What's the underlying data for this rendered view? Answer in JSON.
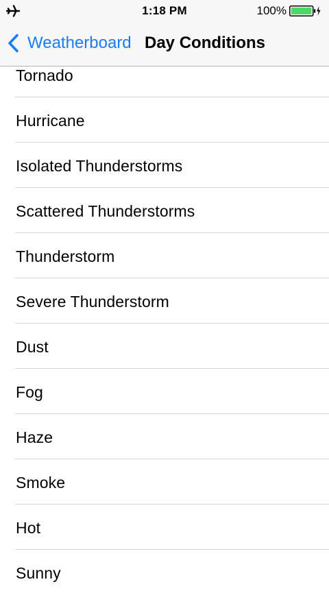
{
  "status_bar": {
    "time": "1:18 PM",
    "battery_percent": "100%",
    "airplane_icon": "airplane-icon",
    "battery_icon": "battery-charging-icon"
  },
  "nav": {
    "back_label": "Weatherboard",
    "back_icon": "chevron-left-icon",
    "title": "Day Conditions",
    "accent_color": "#1a7cf5"
  },
  "list": {
    "items": [
      {
        "label": "Tornado"
      },
      {
        "label": "Hurricane"
      },
      {
        "label": "Isolated Thunderstorms"
      },
      {
        "label": "Scattered Thunderstorms"
      },
      {
        "label": "Thunderstorm"
      },
      {
        "label": "Severe Thunderstorm"
      },
      {
        "label": "Dust"
      },
      {
        "label": "Fog"
      },
      {
        "label": "Haze"
      },
      {
        "label": "Smoke"
      },
      {
        "label": "Hot"
      },
      {
        "label": "Sunny"
      }
    ]
  }
}
